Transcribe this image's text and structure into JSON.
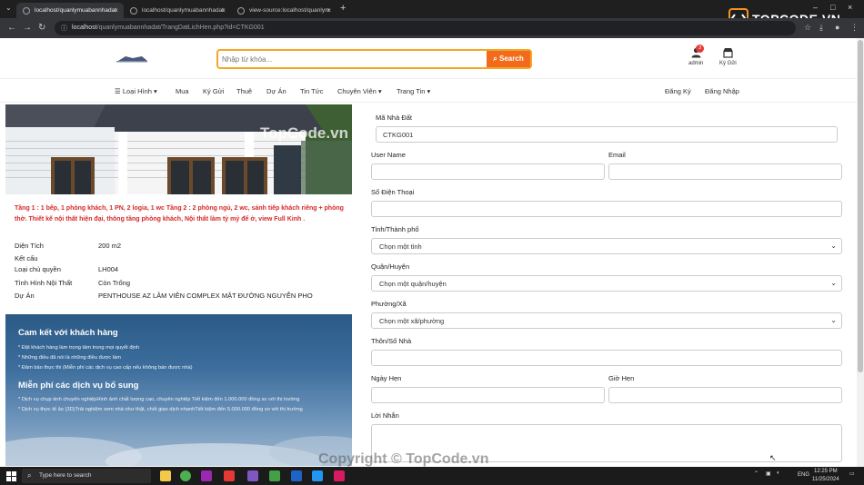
{
  "browser": {
    "tabs": [
      {
        "title": "localhost/quanlymuabannhadat"
      },
      {
        "title": "localhost/quanlymuabannhadat"
      },
      {
        "title": "view-source:localhost/quanlym"
      }
    ],
    "url_host": "localhost",
    "url_path": "/quanlymuabannhadat/TrangDatLichHen.php?id=CTKG001"
  },
  "header": {
    "search_placeholder": "Nhập từ khóa...",
    "search_button": "Search",
    "admin_label": "admin",
    "admin_badge": "3",
    "consign_label": "Ký Gửi"
  },
  "nav": {
    "items": [
      "Loại Hình",
      "Mua",
      "Ký Gửi",
      "Thuê",
      "Dự Án",
      "Tin Tức",
      "Chuyên Viên",
      "Trang Tin"
    ],
    "register": "Đăng Ký",
    "login": "Đăng Nhập"
  },
  "listing": {
    "description": "Tầng 1 : 1 bếp, 1 phòng khách, 1 PN, 2 logia, 1 wc Tầng 2 : 2 phòng ngủ, 2 wc, sảnh tiếp khách riêng + phòng thờ. Thiết kế nội thất hiện đại, thông tầng phòng khách, Nội thất làm tỷ mỷ để ở, view Full Kinh .",
    "specs": [
      {
        "label": "Diện Tích",
        "value": "200 m2"
      },
      {
        "label": "Kết cấu",
        "value": ""
      },
      {
        "label": "Loại chủ quyền",
        "value": "LH004"
      },
      {
        "label": "Tình Hình Nội Thất",
        "value": "Còn Trống"
      },
      {
        "label": "Dự Án",
        "value": "PENTHOUSE AZ LÂM VIÊN COMPLEX MẶT ĐƯỜNG NGUYỄN PHO"
      }
    ]
  },
  "promo": {
    "title1": "Cam kết với khách hàng",
    "items1": [
      "* Đặt khách hàng làm trọng tâm trong mọi quyết định",
      "* Những điều đã nói là những điều được làm",
      "* Đảm bảo thực thi (Miễn phí các dịch vụ cao cấp nếu không bán được nhà)"
    ],
    "title2": "Miễn phí các dịch vụ bổ sung",
    "items2": [
      "* Dịch vụ chụp ảnh chuyên nghiệpHình ảnh chất lượng cao, chuyên nghiệp Tiết kiệm đến 1.000.000 đồng so với thị trường",
      "* Dịch vụ thực tế ảo (3D)Trải nghiệm xem nhà như thật, chốt giao dịch nhanhTiết kiệm đến 5.000.000 đồng so với thị trường"
    ]
  },
  "form": {
    "ma_nha_dat_label": "Mã Nhà Đất",
    "ma_nha_dat_value": "CTKG001",
    "username_label": "User Name",
    "email_label": "Email",
    "phone_label": "Số Điện Thoại",
    "province_label": "Tỉnh/Thành phố",
    "province_value": "Chọn một tỉnh",
    "district_label": "Quận/Huyện",
    "district_value": "Chọn một quận/huyện",
    "ward_label": "Phường/Xã",
    "ward_value": "Chọn một xã/phường",
    "village_label": "Thôn/Số Nhà",
    "date_label": "Ngày Hẹn",
    "time_label": "Giờ Hẹn",
    "message_label": "Lời Nhắn"
  },
  "watermarks": {
    "photo": "TopCode.vn",
    "footer": "Copyright © TopCode.vn",
    "logo": "TOPCODE.VN"
  },
  "taskbar": {
    "search_placeholder": "Type here to search",
    "lang": "ENG",
    "time": "12:25 PM",
    "date": "11/25/2024"
  }
}
